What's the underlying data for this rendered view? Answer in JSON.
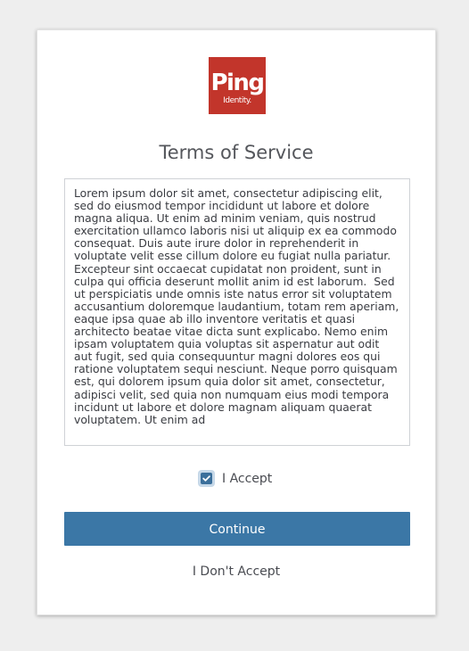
{
  "brand": {
    "logo_word": "Ping",
    "logo_sub": "Identity.",
    "logo_color": "#c2352b"
  },
  "page": {
    "title": "Terms of Service"
  },
  "terms": {
    "text": "Lorem ipsum dolor sit amet, consectetur adipiscing elit, sed do eiusmod tempor incididunt ut labore et dolore magna aliqua. Ut enim ad minim veniam, quis nostrud exercitation ullamco laboris nisi ut aliquip ex ea commodo consequat. Duis aute irure dolor in reprehenderit in voluptate velit esse cillum dolore eu fugiat nulla pariatur. Excepteur sint occaecat cupidatat non proident, sunt in culpa qui officia deserunt mollit anim id est laborum.  Sed ut perspiciatis unde omnis iste natus error sit voluptatem accusantium doloremque laudantium, totam rem aperiam, eaque ipsa quae ab illo inventore veritatis et quasi architecto beatae vitae dicta sunt explicabo. Nemo enim ipsam voluptatem quia voluptas sit aspernatur aut odit aut fugit, sed quia consequuntur magni dolores eos qui ratione voluptatem sequi nesciunt. Neque porro quisquam est, qui dolorem ipsum quia dolor sit amet, consectetur, adipisci velit, sed quia non numquam eius modi tempora incidunt ut labore et dolore magnam aliquam quaerat voluptatem. Ut enim ad"
  },
  "accept": {
    "label": "I Accept",
    "checked": true,
    "check_color": "#3b6f9b"
  },
  "actions": {
    "continue_label": "Continue",
    "continue_color": "#3b77a6",
    "decline_label": "I Don't Accept"
  },
  "icons": {
    "checkbox_check": "check-icon"
  }
}
